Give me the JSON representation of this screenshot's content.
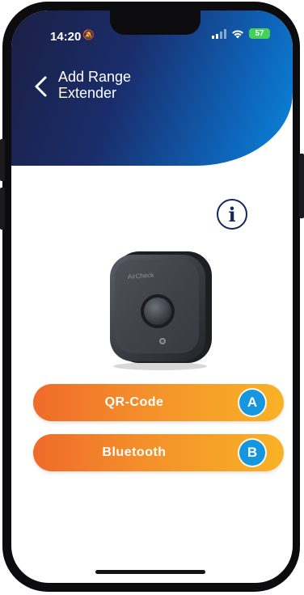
{
  "status": {
    "time": "14:20",
    "bell_icon": "bell-slash-icon",
    "battery": "57"
  },
  "header": {
    "back_icon": "chevron-left-icon",
    "title": "Add Range Extender"
  },
  "info": {
    "icon": "info-icon",
    "label": "i"
  },
  "device": {
    "brand_text": "AirCheck",
    "image": "range-extender-device"
  },
  "actions": [
    {
      "label": "QR-Code",
      "badge": "A"
    },
    {
      "label": "Bluetooth",
      "badge": "B"
    }
  ],
  "colors": {
    "header_gradient": [
      "#1b1f44",
      "#0a86dc"
    ],
    "button_gradient": [
      "#f06a2a",
      "#f8b226"
    ],
    "badge": "#1496e0",
    "battery": "#43d15c"
  }
}
